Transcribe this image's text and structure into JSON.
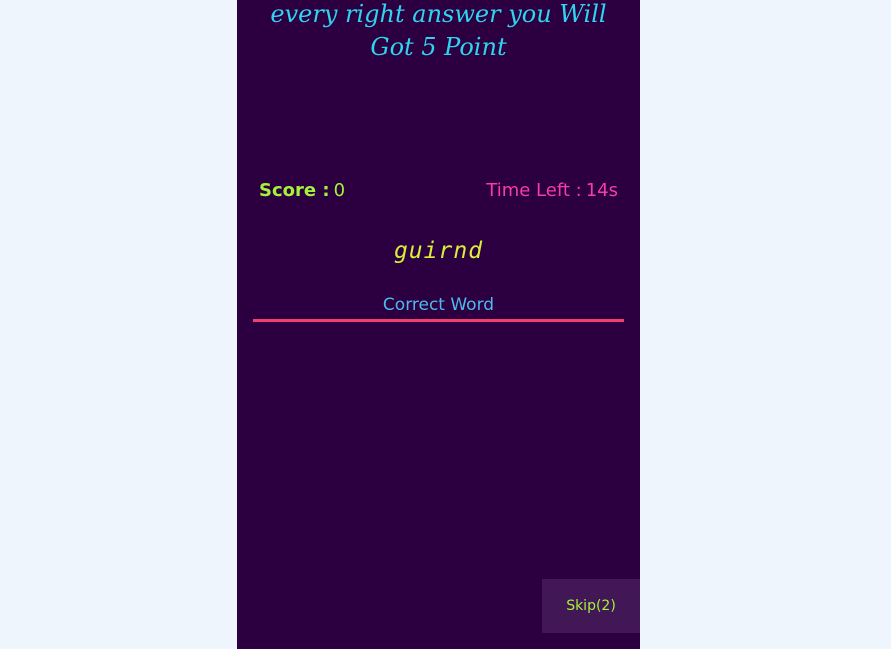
{
  "game": {
    "instruction": "every right answer you Will Got 5 Point",
    "score_label": "Score :",
    "score_value": "0",
    "time_label": "Time Left :",
    "time_value": "14s",
    "scrambled_word": "guirnd",
    "answer_placeholder": "Correct Word",
    "skip_label": "Skip(2)"
  },
  "colors": {
    "panel_background": "#2c0040",
    "page_background": "#eff5fd",
    "instruction": "#2fd4f0",
    "score": "#a5f23a",
    "timer": "#f43da6",
    "scrambled": "#d9ef3a",
    "input_underline": "#ef3f73",
    "input_text": "#4fb8ef",
    "skip_background": "#421755"
  }
}
